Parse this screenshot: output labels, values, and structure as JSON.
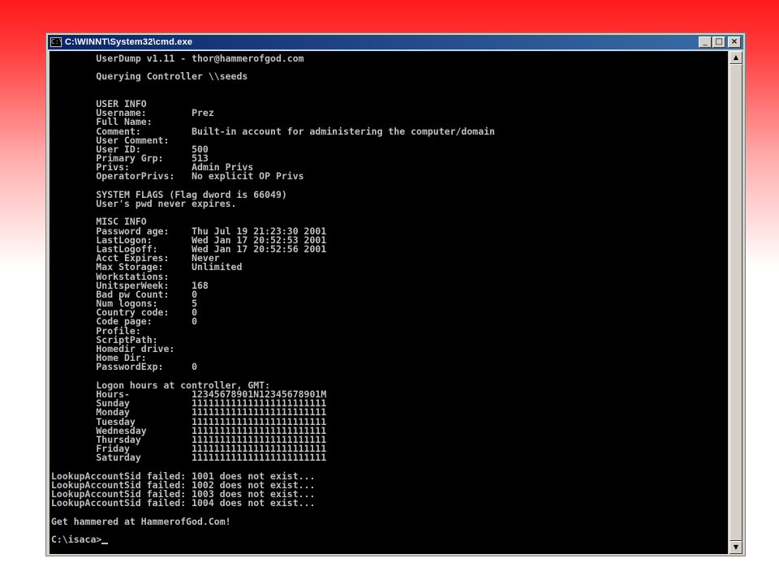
{
  "window": {
    "title": "C:\\WINNT\\System32\\cmd.exe",
    "minimize_label": "_",
    "maximize_label": "□",
    "close_label": "×"
  },
  "console": {
    "lines": [
      "        UserDump v1.11 - thor@hammerofgod.com",
      "",
      "        Querying Controller \\\\seeds",
      "",
      "",
      "        USER INFO",
      "        Username:        Prez",
      "        Full Name:",
      "        Comment:         Built-in account for administering the computer/domain",
      "        User Comment:",
      "        User ID:         500",
      "        Primary Grp:     513",
      "        Privs:           Admin Privs",
      "        OperatorPrivs:   No explicit OP Privs",
      "",
      "        SYSTEM FLAGS (Flag dword is 66049)",
      "        User's pwd never expires.",
      "",
      "        MISC INFO",
      "        Password age:    Thu Jul 19 21:23:30 2001",
      "        LastLogon:       Wed Jan 17 20:52:53 2001",
      "        LastLogoff:      Wed Jan 17 20:52:56 2001",
      "        Acct Expires:    Never",
      "        Max Storage:     Unlimited",
      "        Workstations:",
      "        UnitsperWeek:    168",
      "        Bad pw Count:    0",
      "        Num logons:      5",
      "        Country code:    0",
      "        Code page:       0",
      "        Profile:",
      "        ScriptPath:",
      "        Homedir drive:",
      "        Home Dir:",
      "        PasswordExp:     0",
      "",
      "        Logon hours at controller, GMT:",
      "        Hours-           12345678901N12345678901M",
      "        Sunday           111111111111111111111111",
      "        Monday           111111111111111111111111",
      "        Tuesday          111111111111111111111111",
      "        Wednesday        111111111111111111111111",
      "        Thursday         111111111111111111111111",
      "        Friday           111111111111111111111111",
      "        Saturday         111111111111111111111111",
      "",
      "LookupAccountSid failed: 1001 does not exist...",
      "LookupAccountSid failed: 1002 does not exist...",
      "LookupAccountSid failed: 1003 does not exist...",
      "LookupAccountSid failed: 1004 does not exist...",
      "",
      "Get hammered at HammerofGod.Com!",
      "",
      "C:\\isaca>"
    ]
  },
  "colors": {
    "console_bg": "#000000",
    "console_text": "#c0c0c0",
    "titlebar_start": "#0a246a",
    "titlebar_end": "#3a6ea5"
  },
  "icons": {
    "app": "cmd-icon",
    "scroll_up": "arrow-up-icon",
    "scroll_down": "arrow-down-icon"
  }
}
